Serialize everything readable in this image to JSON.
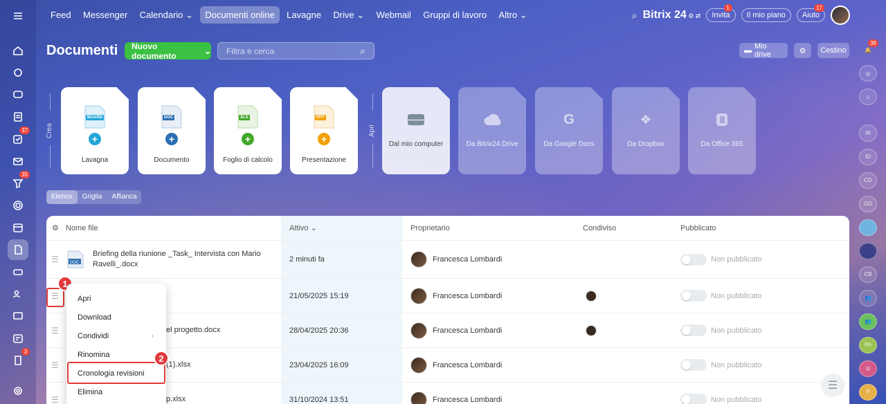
{
  "topnav": {
    "items": [
      "Feed",
      "Messenger",
      "Calendario",
      "Documenti online",
      "Lavagne",
      "Drive",
      "Webmail",
      "Gruppi di lavoro",
      "Altro"
    ],
    "selected": "Documenti online",
    "brand": "Bitrix",
    "brand_num": "24",
    "invite_label": "Invita",
    "invite_badge": "1",
    "plan_label": "Il mio piano",
    "help_label": "Aiuto",
    "help_badge": "17"
  },
  "rail": {
    "badges": {
      "tasks": "37",
      "feed": "35",
      "reports": "3"
    }
  },
  "rrail": {
    "bell_badge": "38",
    "initials": [
      "IR",
      "ID",
      "CD",
      "GD",
      "CB",
      "PA",
      "P"
    ]
  },
  "header": {
    "title": "Documenti",
    "new_doc": "Nuovo documento",
    "search_placeholder": "Filtra e cerca",
    "my_drive": "Mio drive",
    "trash": "Cestino"
  },
  "create": {
    "label_create": "Crea",
    "label_open": "Apri",
    "tiles": [
      {
        "label": "Lavagna",
        "tag": "BOARD",
        "color": "#24a6d8"
      },
      {
        "label": "Documento",
        "tag": "DOC",
        "color": "#2d6fb0"
      },
      {
        "label": "Foglio di calcolo",
        "tag": "XLS",
        "color": "#43a72a"
      },
      {
        "label": "Presentazione",
        "tag": "PPT",
        "color": "#f2a006"
      }
    ],
    "open_tiles": [
      "Dal mio computer",
      "Da Bitrix24.Drive",
      "Da Google Docs",
      "Da Dropbox",
      "Da Office 365"
    ]
  },
  "views": [
    "Elenco",
    "Griglia",
    "Affianca"
  ],
  "table": {
    "columns": {
      "name": "Nome file",
      "active": "Attivo",
      "owner": "Proprietario",
      "shared": "Condiviso",
      "published": "Pubblicato"
    },
    "rows": [
      {
        "name": "Briefing della riunione _Task_ Intervista con Mario Ravelli_.docx",
        "date": "2 minuti fa",
        "owner": "Francesca Lombardi",
        "shared": false,
        "pub": "Non pubblicato",
        "tag": "DOC"
      },
      {
        "name": "",
        "date": "21/05/2025 15:19",
        "owner": "Francesca Lombardi",
        "shared": true,
        "pub": "Non pubblicato"
      },
      {
        "name": "el progetto.docx",
        "date": "28/04/2025 20:36",
        "owner": "Francesca Lombardi",
        "shared": true,
        "pub": "Non pubblicato"
      },
      {
        "name": "(1).xlsx",
        "date": "23/04/2025 16:09",
        "owner": "Francesca Lombardi",
        "shared": false,
        "pub": "Non pubblicato"
      },
      {
        "name": "p.xlsx",
        "date": "31/10/2024 13:51",
        "owner": "Francesca Lombardi",
        "shared": false,
        "pub": "Non pubblicato"
      }
    ]
  },
  "menu": {
    "items": [
      "Apri",
      "Download",
      "Condividi",
      "Rinomina",
      "Cronologia revisioni",
      "Elimina"
    ]
  },
  "callouts": [
    "1",
    "2"
  ]
}
